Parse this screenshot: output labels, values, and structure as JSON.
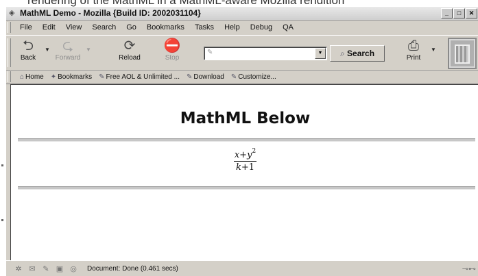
{
  "caption": "rendering of the MathML in a MathML-aware Mozilla rendition",
  "window": {
    "title": "MathML Demo - Mozilla {Build ID: 2002031104}",
    "controls": {
      "minimize": "_",
      "maximize": "□",
      "close": "✕"
    }
  },
  "menu": [
    "File",
    "Edit",
    "View",
    "Search",
    "Go",
    "Bookmarks",
    "Tasks",
    "Help",
    "Debug",
    "QA"
  ],
  "toolbar": {
    "back": "Back",
    "forward": "Forward",
    "reload": "Reload",
    "stop": "Stop",
    "url_value": "",
    "search": "Search",
    "print": "Print"
  },
  "personal_toolbar": [
    "Home",
    "Bookmarks",
    "Free AOL & Unlimited ...",
    "Download",
    "Customize..."
  ],
  "page": {
    "heading": "MathML Below",
    "math": {
      "num_a": "x",
      "op": "+",
      "num_b": "y",
      "exp": "2",
      "den_a": "k",
      "den_op": "+",
      "den_b": "1"
    }
  },
  "status": {
    "text": "Document: Done (0.461 secs)"
  }
}
